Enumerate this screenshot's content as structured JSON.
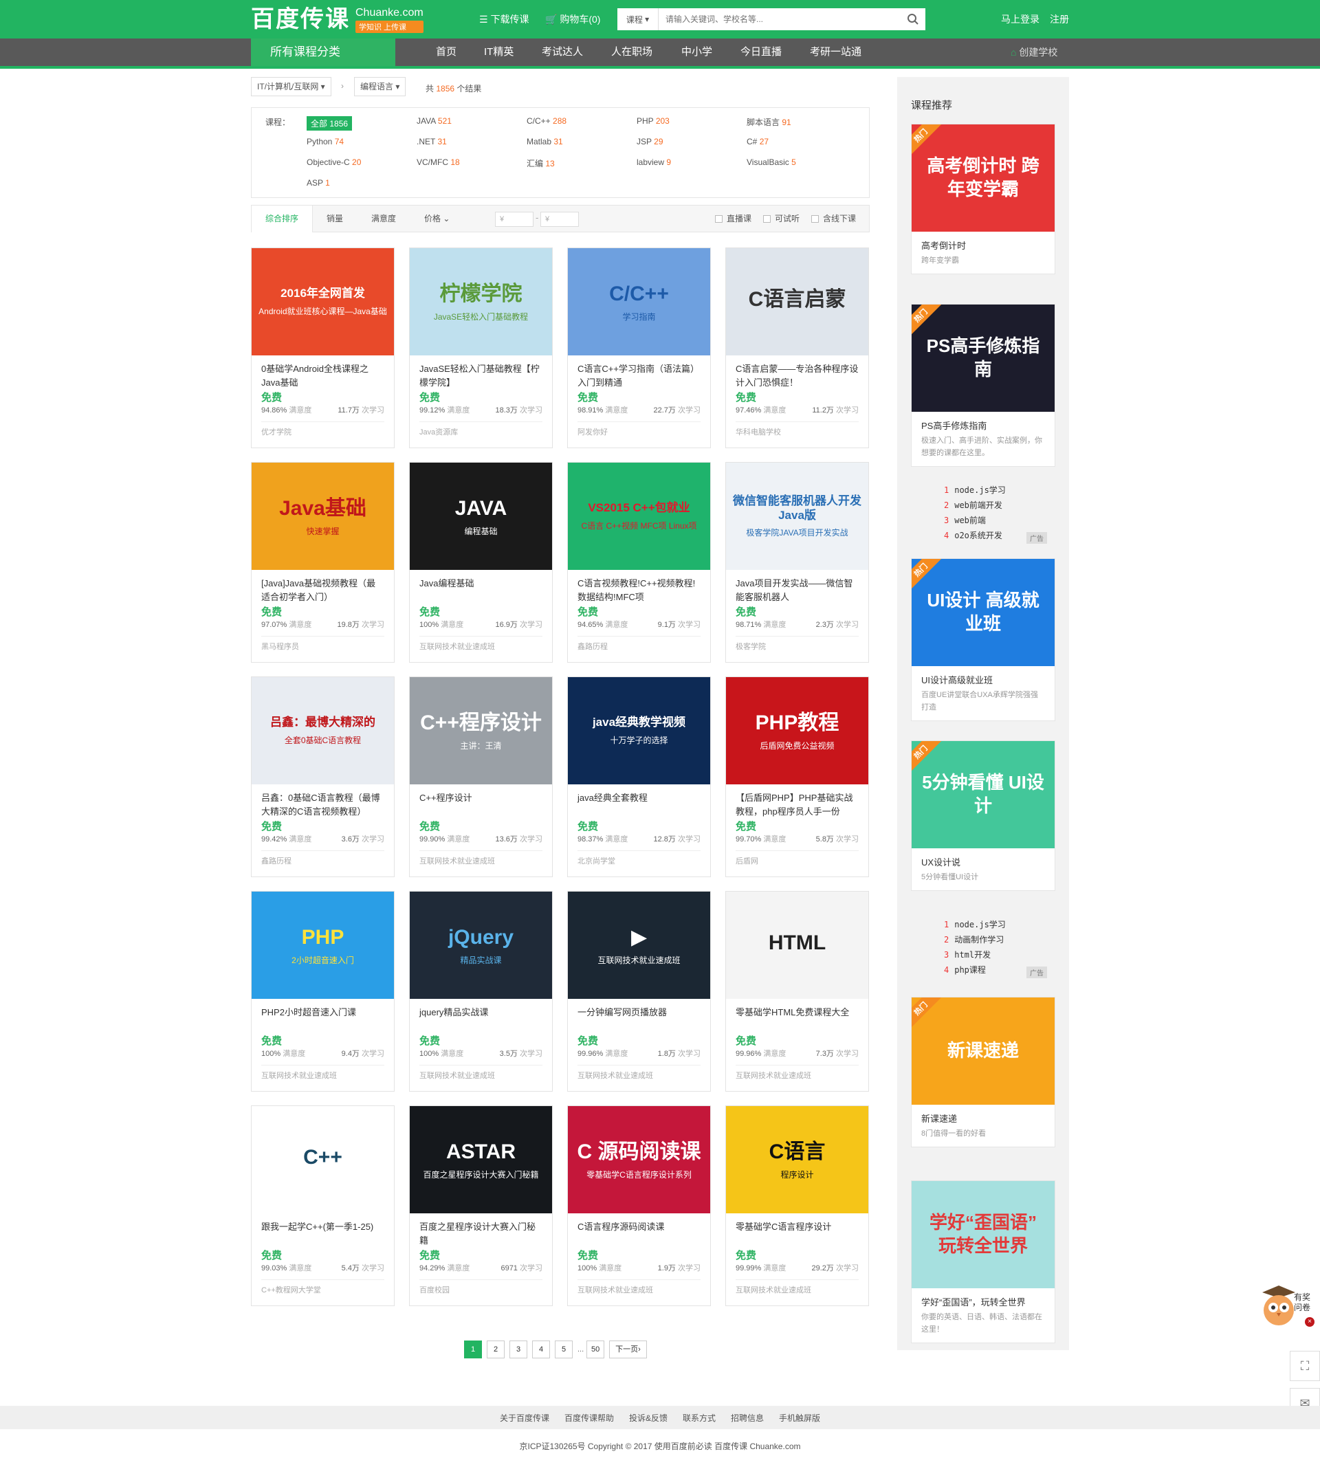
{
  "header": {
    "logo_cn": "百度传课",
    "logo_en": "Chuanke.com",
    "slogan": "学知识 上传课",
    "download": "下载传课",
    "cart": "购物车(0)",
    "search_cat": "课程",
    "search_placeholder": "请输入关键词、学校名等...",
    "login": "马上登录",
    "register": "注册"
  },
  "nav": {
    "allcat": "所有课程分类",
    "items": [
      "首页",
      "IT精英",
      "考试达人",
      "人在职场",
      "中小学",
      "今日直播",
      "考研一站通"
    ],
    "create": "创建学校"
  },
  "crumb": {
    "cat1": "IT/计算机/互联网",
    "cat2": "编程语言",
    "result_prefix": "共",
    "result_count": "1856",
    "result_suffix": "个结果"
  },
  "filter": {
    "label": "课程：",
    "items": [
      [
        "全部",
        "1856"
      ],
      [
        "JAVA",
        "521"
      ],
      [
        "C/C++",
        "288"
      ],
      [
        "PHP",
        "203"
      ],
      [
        "脚本语言",
        "91"
      ],
      [
        "Python",
        "74"
      ],
      [
        ".NET",
        "31"
      ],
      [
        "Matlab",
        "31"
      ],
      [
        "JSP",
        "29"
      ],
      [
        "C#",
        "27"
      ],
      [
        "Objective-C",
        "20"
      ],
      [
        "VC/MFC",
        "18"
      ],
      [
        "汇编",
        "13"
      ],
      [
        "labview",
        "9"
      ],
      [
        "VisualBasic",
        "5"
      ],
      [
        "ASP",
        "1"
      ]
    ]
  },
  "sort": {
    "items": [
      "综合排序",
      "销量",
      "满意度",
      "价格"
    ],
    "price_min": "¥",
    "price_max": "¥",
    "checks": [
      "直播课",
      "可试听",
      "含线下课"
    ]
  },
  "courses": [
    {
      "title": "0基础学Android全栈课程之Java基础",
      "price": "免费",
      "rate": "94.86%",
      "rate_label": "满意度",
      "learn": "11.7万",
      "learn_label": "次学习",
      "school": "优才学院",
      "thumb": "2016年全网首发",
      "thumb_sub": "Android就业班核心课程—Java基础",
      "bg": "#e84a2a",
      "fg": "#fff"
    },
    {
      "title": "JavaSE轻松入门基础教程【柠檬学院】",
      "price": "免费",
      "rate": "99.12%",
      "rate_label": "满意度",
      "learn": "18.3万",
      "learn_label": "次学习",
      "school": "Java资源库",
      "thumb": "柠檬学院",
      "thumb_sub": "JavaSE轻松入门基础教程",
      "bg": "#bfe0ee",
      "fg": "#5a9a3a"
    },
    {
      "title": "C语言C++学习指南（语法篇）入门到精通",
      "price": "免费",
      "rate": "98.91%",
      "rate_label": "满意度",
      "learn": "22.7万",
      "learn_label": "次学习",
      "school": "阿发你好",
      "thumb": "C/C++",
      "thumb_sub": "学习指南",
      "bg": "#6ea0df",
      "fg": "#1d5aa8"
    },
    {
      "title": "C语言启蒙——专治各种程序设计入门恐惧症！",
      "price": "免费",
      "rate": "97.46%",
      "rate_label": "满意度",
      "learn": "11.2万",
      "learn_label": "次学习",
      "school": "华科电脑学校",
      "thumb": "C语言启蒙",
      "thumb_sub": "",
      "bg": "#dfe5ec",
      "fg": "#333"
    },
    {
      "title": "[Java]Java基础视频教程（最适合初学者入门）",
      "price": "免费",
      "rate": "97.07%",
      "rate_label": "满意度",
      "learn": "19.8万",
      "learn_label": "次学习",
      "school": "黑马程序员",
      "thumb": "Java基础",
      "thumb_sub": "快速掌握",
      "bg": "#f0a21d",
      "fg": "#c0171b"
    },
    {
      "title": "Java编程基础",
      "price": "免费",
      "rate": "100%",
      "rate_label": "满意度",
      "learn": "16.9万",
      "learn_label": "次学习",
      "school": "互联网技术就业速成班",
      "thumb": "JAVA",
      "thumb_sub": "编程基础",
      "bg": "#1a1a1a",
      "fg": "#fff"
    },
    {
      "title": "C语言视频教程!C++视频教程!数据结构!MFC项",
      "price": "免费",
      "rate": "94.65%",
      "rate_label": "满意度",
      "learn": "9.1万",
      "learn_label": "次学习",
      "school": "鑫路历程",
      "thumb": "VS2015 C++包就业",
      "thumb_sub": "C语言 C++视频 MFC项 Linux项",
      "bg": "#1fb36c",
      "fg": "#e2182c"
    },
    {
      "title": "Java项目开发实战——微信智能客服机器人",
      "price": "免费",
      "rate": "98.71%",
      "rate_label": "满意度",
      "learn": "2.3万",
      "learn_label": "次学习",
      "school": "极客学院",
      "thumb": "微信智能客服机器人开发Java版",
      "thumb_sub": "极客学院JAVA项目开发实战",
      "bg": "#eef2f6",
      "fg": "#2a6fb5"
    },
    {
      "title": "吕鑫：0基础C语言教程（最博大精深的C语言视频教程）",
      "price": "免费",
      "rate": "99.42%",
      "rate_label": "满意度",
      "learn": "3.6万",
      "learn_label": "次学习",
      "school": "鑫路历程",
      "thumb": "吕鑫：最博大精深的",
      "thumb_sub": "全套0基础C语言教程",
      "bg": "#e8ecf2",
      "fg": "#c0171b"
    },
    {
      "title": "C++程序设计",
      "price": "免费",
      "rate": "99.90%",
      "rate_label": "满意度",
      "learn": "13.6万",
      "learn_label": "次学习",
      "school": "互联网技术就业速成班",
      "thumb": "C++程序设计",
      "thumb_sub": "主讲：王清",
      "bg": "#9aa0a6",
      "fg": "#fff"
    },
    {
      "title": "java经典全套教程",
      "price": "免费",
      "rate": "98.37%",
      "rate_label": "满意度",
      "learn": "12.8万",
      "learn_label": "次学习",
      "school": "北京尚学堂",
      "thumb": "java经典教学视频",
      "thumb_sub": "十万学子的选择",
      "bg": "#0d2a55",
      "fg": "#fff"
    },
    {
      "title": "【后盾网PHP】PHP基础实战教程，php程序员人手一份",
      "price": "免费",
      "rate": "99.70%",
      "rate_label": "满意度",
      "learn": "5.8万",
      "learn_label": "次学习",
      "school": "后盾网",
      "thumb": "PHP教程",
      "thumb_sub": "后盾网免费公益视频",
      "bg": "#c8151b",
      "fg": "#fff"
    },
    {
      "title": "PHP2小时超音速入门课",
      "price": "免费",
      "rate": "100%",
      "rate_label": "满意度",
      "learn": "9.4万",
      "learn_label": "次学习",
      "school": "互联网技术就业速成班",
      "thumb": "PHP",
      "thumb_sub": "2小时超音速入门",
      "bg": "#2a9ee6",
      "fg": "#ffe23a"
    },
    {
      "title": "jquery精品实战课",
      "price": "免费",
      "rate": "100%",
      "rate_label": "满意度",
      "learn": "3.5万",
      "learn_label": "次学习",
      "school": "互联网技术就业速成班",
      "thumb": "jQuery",
      "thumb_sub": "精品实战课",
      "bg": "#1f2a38",
      "fg": "#5ab3ea"
    },
    {
      "title": "一分钟编写网页播放器",
      "price": "免费",
      "rate": "99.96%",
      "rate_label": "满意度",
      "learn": "1.8万",
      "learn_label": "次学习",
      "school": "互联网技术就业速成班",
      "thumb": "▶",
      "thumb_sub": "互联网技术就业速成班",
      "bg": "#1b2733",
      "fg": "#fff"
    },
    {
      "title": "零基础学HTML免费课程大全",
      "price": "免费",
      "rate": "99.96%",
      "rate_label": "满意度",
      "learn": "7.3万",
      "learn_label": "次学习",
      "school": "互联网技术就业速成班",
      "thumb": "HTML",
      "thumb_sub": "",
      "bg": "#f4f4f4",
      "fg": "#222"
    },
    {
      "title": "跟我一起学C++(第一季1-25)",
      "price": "免费",
      "rate": "99.03%",
      "rate_label": "满意度",
      "learn": "5.4万",
      "learn_label": "次学习",
      "school": "C++教程网大学堂",
      "thumb": "C++",
      "thumb_sub": "",
      "bg": "#fff",
      "fg": "#1a4a66"
    },
    {
      "title": "百度之星程序设计大赛入门秘籍",
      "price": "免费",
      "rate": "94.29%",
      "rate_label": "满意度",
      "learn": "6971",
      "learn_label": "次学习",
      "school": "百度校园",
      "thumb": "ASTAR",
      "thumb_sub": "百度之星程序设计大赛入门秘籍",
      "bg": "#15181c",
      "fg": "#fff"
    },
    {
      "title": "C语言程序源码阅读课",
      "price": "免费",
      "rate": "100%",
      "rate_label": "满意度",
      "learn": "1.9万",
      "learn_label": "次学习",
      "school": "互联网技术就业速成班",
      "thumb": "C 源码阅读课",
      "thumb_sub": "零基础学C语言程序设计系列",
      "bg": "#c4173a",
      "fg": "#fff"
    },
    {
      "title": "零基础学C语言程序设计",
      "price": "免费",
      "rate": "99.99%",
      "rate_label": "满意度",
      "learn": "29.2万",
      "learn_label": "次学习",
      "school": "互联网技术就业速成班",
      "thumb": "C语言",
      "thumb_sub": "程序设计",
      "bg": "#f5c518",
      "fg": "#111"
    }
  ],
  "pager": {
    "pages": [
      "1",
      "2",
      "3",
      "4",
      "5",
      "...",
      "50"
    ],
    "next": "下一页›"
  },
  "sidebar": {
    "title": "课程推荐",
    "hot_label": "热门",
    "cards": [
      {
        "img": "高考倒计时 跨年变学霸",
        "title": "高考倒计时",
        "desc": "跨年变学霸",
        "bg": "#e53636",
        "fg": "#fff"
      },
      {
        "img": "PS高手修炼指南",
        "title": "PS高手修炼指南",
        "desc": "极速入门、高手进阶、实战案例，你想要的课都在这里。",
        "bg": "#1c1c2c",
        "fg": "#fff"
      },
      {
        "img": "UI设计 高级就业班",
        "title": "UI设计高级就业班",
        "desc": "百度UE讲堂联合UXA承辉学院强强打造",
        "bg": "#1f7de0",
        "fg": "#fff"
      },
      {
        "img": "5分钟看懂 UI设计",
        "title": "UX设计说",
        "desc": "5分钟看懂UI设计",
        "bg": "#43c79a",
        "fg": "#fff"
      },
      {
        "img": "新课速递",
        "title": "新课速递",
        "desc": "8门值得一看的好看",
        "bg": "#f7a51b",
        "fg": "#fff"
      },
      {
        "img": "学好“歪国语” 玩转全世界",
        "title": "学好“歪国语”，玩转全世界",
        "desc": "你要的英语、日语、韩语、法语都在这里！",
        "bg": "#a6e0df",
        "fg": "#e23a3a"
      }
    ],
    "list1": [
      [
        "1",
        "node.js学习"
      ],
      [
        "2",
        "web前端开发"
      ],
      [
        "3",
        "web前端"
      ],
      [
        "4",
        "o2o系统开发"
      ]
    ],
    "list2": [
      [
        "1",
        "node.js学习"
      ],
      [
        "2",
        "动画制作学习"
      ],
      [
        "3",
        "html开发"
      ],
      [
        "4",
        "php课程"
      ]
    ],
    "ad_label": "广告"
  },
  "footer": {
    "links": [
      "关于百度传课",
      "百度传课帮助",
      "投诉&反馈",
      "联系方式",
      "招聘信息",
      "手机触屏版"
    ],
    "copy": "京ICP证130265号    Copyright © 2017 使用百度前必读    百度传课 Chuanke.com"
  },
  "survey": {
    "label": "有奖问卷"
  },
  "colors": {
    "brand": "#22b461",
    "nav": "#595959",
    "accent": "#f56a22"
  }
}
